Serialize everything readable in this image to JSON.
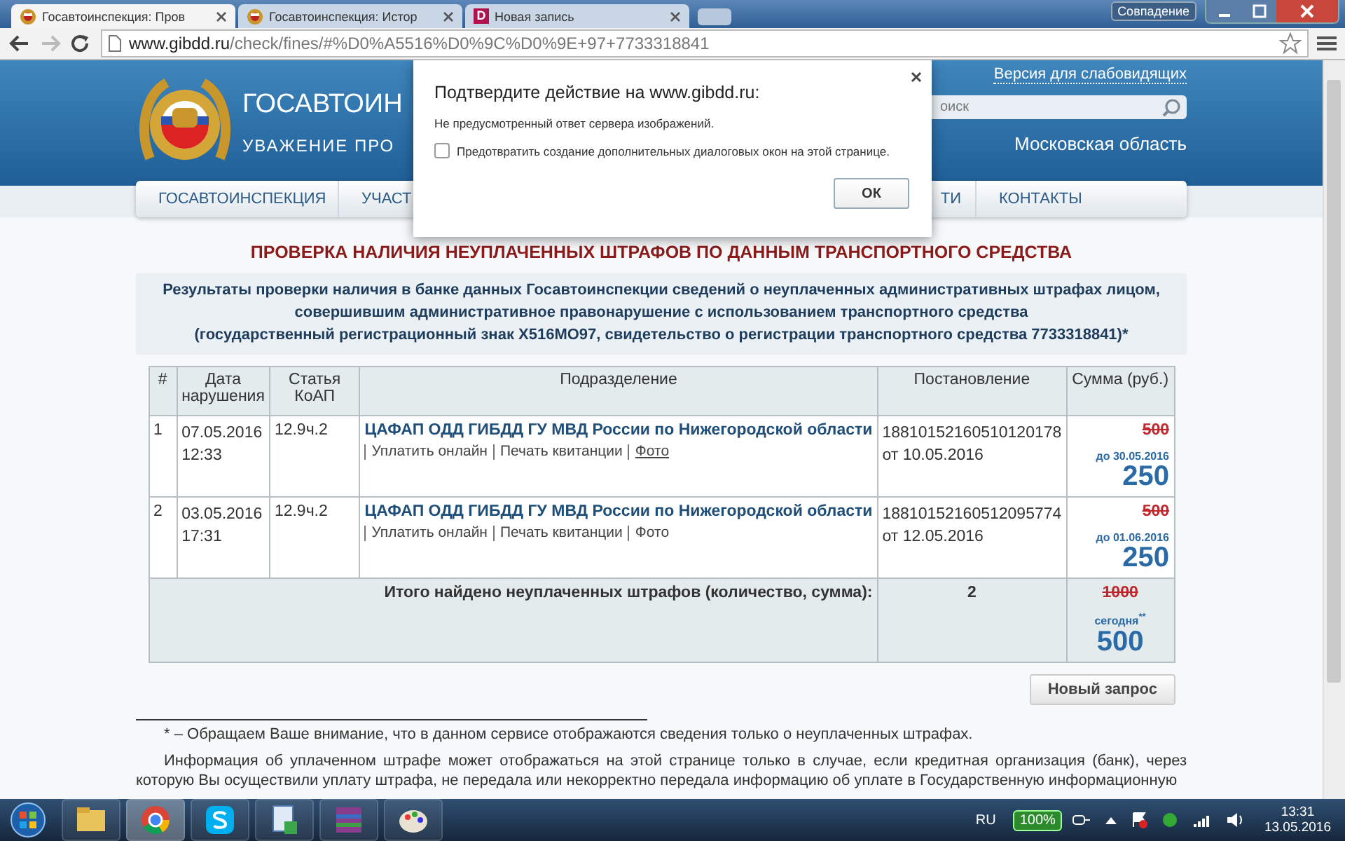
{
  "browser": {
    "tabs": [
      {
        "title": "Госавтоинспекция: Пров",
        "selected": true
      },
      {
        "title": "Госавтоинспекция: Истор",
        "selected": false
      },
      {
        "title": "Новая запись",
        "selected": false,
        "icon_text": "D"
      }
    ],
    "match_badge": "Совпадение",
    "url_host": "www.gibdd.ru",
    "url_path": "/check/fines/#%D0%A5516%D0%9C%D0%9E+97+7733318841"
  },
  "header": {
    "title": "ГОСАВТОИН",
    "slogan": "УВАЖЕНИЕ ПРО",
    "accessibility_link": "Версия для слабовидящих",
    "search": {
      "placeholder": "оиск"
    },
    "region": "Московская область"
  },
  "nav": [
    {
      "label": "ГОСАВТОИНСПЕКЦИЯ"
    },
    {
      "label": "УЧАСТ"
    },
    {
      "label": "ТИ"
    },
    {
      "label": "КОНТАКТЫ"
    }
  ],
  "dialog": {
    "title": "Подтвердите действие на www.gibdd.ru:",
    "message": "Не предусмотренный ответ сервера изображений.",
    "checkbox": {
      "label": "Предотвратить создание дополнительных диалоговых окон на этой странице.",
      "checked": false
    },
    "ok": "ОК"
  },
  "heading": "ПРОВЕРКА НАЛИЧИЯ НЕУПЛАЧЕННЫХ ШТРАФОВ ПО ДАННЫМ ТРАНСПОРТНОГО СРЕДСТВА",
  "summary": "Результаты проверки наличия в банке данных Госавтоинспекции сведений о неуплаченных административных штрафах лицом,\nсовершившим административное правонарушение с использованием транспортного средства\n(государственный регистрационный знак Х516МО97, свидетельство о регистрации транспортного средства 7733318841)*",
  "table": {
    "columns": [
      "#",
      "Дата нарушения",
      "Статья КоАП",
      "Подразделение",
      "Постановление",
      "Сумма (руб.)"
    ],
    "rows": [
      {
        "number": "1",
        "date": "07.05.2016",
        "time": "12:33",
        "article": "12.9ч.2",
        "department": "ЦАФАП ОДД ГИБДД ГУ МВД России по Нижегородской области",
        "links": [
          {
            "label": "Уплатить онлайн",
            "hovered": false
          },
          {
            "label": "Печать квитанции",
            "hovered": false
          },
          {
            "label": "Фото",
            "hovered": true
          }
        ],
        "decree": "18810152160510120178",
        "decree_date": "от 10.05.2016",
        "old_amount": "500",
        "discount_note": "до 30.05.2016",
        "amount": "250"
      },
      {
        "number": "2",
        "date": "03.05.2016",
        "time": "17:31",
        "article": "12.9ч.2",
        "department": "ЦАФАП ОДД ГИБДД ГУ МВД России по Нижегородской области",
        "links": [
          {
            "label": "Уплатить онлайн",
            "hovered": false
          },
          {
            "label": "Печать квитанции",
            "hovered": false
          },
          {
            "label": "Фото",
            "hovered": false
          }
        ],
        "decree": "18810152160512095774",
        "decree_date": "от 12.05.2016",
        "old_amount": "500",
        "discount_note": "до 01.06.2016",
        "amount": "250"
      }
    ],
    "total": {
      "label": "Итого найдено неуплаченных штрафов (количество, сумма):",
      "count": "2",
      "old_amount": "1000",
      "discount_note": "сегодня$^{**}$",
      "amount": "500"
    }
  },
  "new_request_button": "Новый запрос",
  "footnote": "* – Обращаем Ваше внимание, что в данном сервисе отображаются сведения только о неуплаченных штрафах.",
  "info_paragraph": "Информация об уплаченном штрафе может отображаться на этой странице только в случае, если кредитная организация (банк), через которую Вы осуществили уплату штрафа, не передала или некорректно передала информацию об уплате в Государственную информационную",
  "taskbar": {
    "apps": [
      {
        "kind": "folder",
        "selected": false
      },
      {
        "kind": "chrome",
        "selected": true
      },
      {
        "kind": "skype",
        "selected": false
      },
      {
        "kind": "doc",
        "selected": false
      },
      {
        "kind": "archive",
        "selected": false
      },
      {
        "kind": "paint",
        "selected": false
      }
    ],
    "language": "RU",
    "battery": "100%",
    "time": "13:31",
    "date": "13.05.2016"
  }
}
